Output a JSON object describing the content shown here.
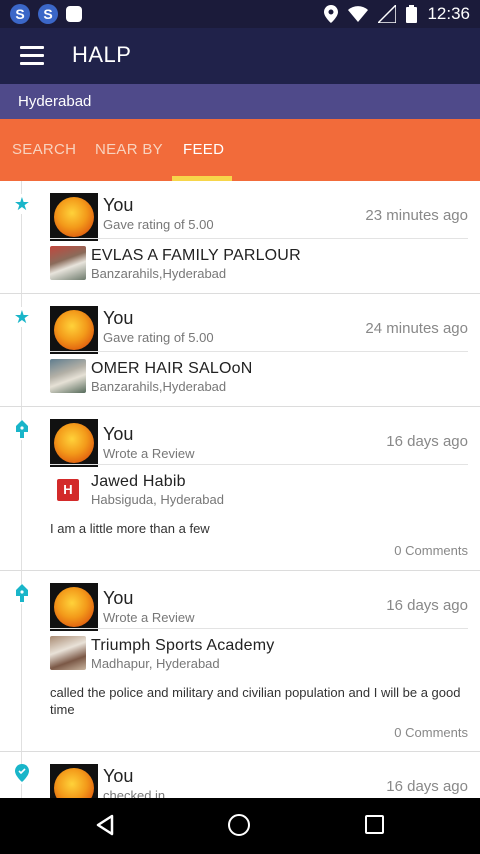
{
  "status_bar": {
    "time": "12:36"
  },
  "app_bar": {
    "title": "HALP"
  },
  "location": {
    "city": "Hyderabad"
  },
  "tabs": [
    {
      "label": "SEARCH"
    },
    {
      "label": "NEAR BY"
    },
    {
      "label": "FEED"
    }
  ],
  "feed": [
    {
      "icon": "star-icon",
      "user": "You",
      "action": "Gave rating of 5.00",
      "time": "23 minutes ago",
      "business": {
        "name": "EVLAS A FAMILY PARLOUR",
        "location": "Banzarahils,Hyderabad"
      }
    },
    {
      "icon": "star-icon",
      "user": "You",
      "action": "Gave rating of 5.00",
      "time": "24 minutes ago",
      "business": {
        "name": "OMER HAIR SALOoN",
        "location": "Banzarahils,Hyderabad"
      }
    },
    {
      "icon": "pen-icon",
      "user": "You",
      "action": "Wrote a Review",
      "time": "16 days ago",
      "business": {
        "name": "Jawed Habib",
        "location": "Habsiguda, Hyderabad",
        "logo_letter": "H"
      },
      "review": "I am a little more than a few",
      "comments": "0 Comments"
    },
    {
      "icon": "pen-icon",
      "user": "You",
      "action": "Wrote a Review",
      "time": "16 days ago",
      "business": {
        "name": "Triumph Sports Academy",
        "location": "Madhapur, Hyderabad"
      },
      "review": "called the police and military and civilian population and I will be a good time",
      "comments": "0 Comments"
    },
    {
      "icon": "checkin-icon",
      "user": "You",
      "action": "checked in",
      "time": "16 days ago"
    }
  ],
  "colors": {
    "status_bar": "#1b1b3a",
    "app_bar": "#20224a",
    "location_bar": "#4f4a8a",
    "tab_bar": "#f26b3a",
    "tab_indicator": "#f7d64a",
    "timeline_icon": "#19b5c9"
  }
}
